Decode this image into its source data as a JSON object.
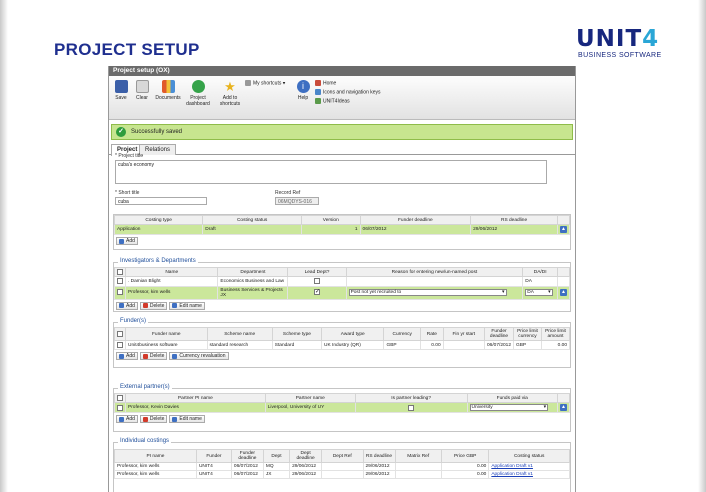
{
  "page_title": "PROJECT SETUP",
  "logo": {
    "word_a": "UNIT",
    "word_b": "4",
    "sub": "BUSINESS SOFTWARE"
  },
  "window_title": "Project setup (OX)",
  "toolbar": {
    "save": "Save",
    "clear": "Clear",
    "documents": "Documents",
    "project_dashboard": "Project dashboard",
    "add_shortcuts": "Add to shortcuts",
    "my_shortcuts": "My shortcuts",
    "help": "Help",
    "home": "Home",
    "icons_keys": "Icons and navigation keys",
    "unit4ideas": "UNIT4Ideas"
  },
  "status_message": "Successfully saved",
  "tabs": [
    "Project",
    "Relations"
  ],
  "form": {
    "project_title_label": "* Project title",
    "project_title_value": "cuba's economy",
    "short_title_label": "* Short title",
    "short_title_value": "cuba",
    "record_ref_label": "Record Ref",
    "record_ref_value": "06MQDYS-016"
  },
  "costing": {
    "headers": [
      "Costing type",
      "Costing status",
      "Version",
      "Funder deadline",
      "RS deadline"
    ],
    "rows": [
      [
        "Application",
        "Draft",
        "1",
        "06/07/2012",
        "29/06/2012"
      ]
    ],
    "add": "Add"
  },
  "investigators": {
    "title": "Investigators & Departments",
    "headers": [
      "Name",
      "Department",
      "Lead Dept?",
      "Reason for entering new/un-named post",
      "DA/DI"
    ],
    "rows": [
      {
        "name": ". Damian Blight",
        "dept": "Economics Business and Law",
        "lead": false,
        "reason": "",
        "da": "DA"
      },
      {
        "name": "Professor, kim wells",
        "dept": "Business Services & Projects JX",
        "lead": true,
        "reason": "Post not yet recruited to",
        "da": "DA"
      }
    ],
    "buttons": [
      "Add",
      "Delete",
      "Edit name"
    ]
  },
  "funders": {
    "title": "Funder(s)",
    "headers": [
      "Funder name",
      "Scheme name",
      "Scheme type",
      "Award type",
      "Currency",
      "Rate",
      "Fin yr start",
      "Funder deadline",
      "Price limit currency",
      "Price limit amount"
    ],
    "rows": [
      [
        "Unit4business software",
        "standard research",
        "Standard",
        "UK Industry (QR)",
        "GBP",
        "0.00",
        "",
        "06/07/2012",
        "GBP",
        "0.00"
      ]
    ],
    "buttons": [
      "Add",
      "Delete",
      "Currency revaluation"
    ]
  },
  "partners": {
    "title": "External partner(s)",
    "headers": [
      "Partner PI name",
      "Partner name",
      "Is partner leading?",
      "Funds paid via"
    ],
    "rows": [
      {
        "pi": "Professor, Kevin Davies",
        "name": "Liverpool, University of UY",
        "leading": false,
        "via": "University"
      }
    ],
    "buttons": [
      "Add",
      "Delete",
      "Edit name"
    ]
  },
  "individual": {
    "title": "Individual costings",
    "headers": [
      "PI name",
      "Funder",
      "Funder deadline",
      "Dept",
      "Dept deadline",
      "Dept Ref",
      "RS deadline",
      "Matrix Ref",
      "Price GBP",
      "Costing status"
    ],
    "rows": [
      [
        "Professor, kim wells",
        "UNIT4",
        "06/07/2012",
        "MQ",
        "29/06/2012",
        "",
        "29/06/2012",
        "",
        "0.00",
        "Application Draft v1"
      ],
      [
        "Professor, kim wells",
        "UNIT4",
        "06/07/2012",
        "JX",
        "29/06/2012",
        "",
        "29/06/2012",
        "",
        "0.00",
        "Application Draft v1"
      ]
    ]
  },
  "colors": {
    "title": "#1f2f8f",
    "success_bg": "#c7e58f",
    "selected_row": "#cbe79b"
  }
}
